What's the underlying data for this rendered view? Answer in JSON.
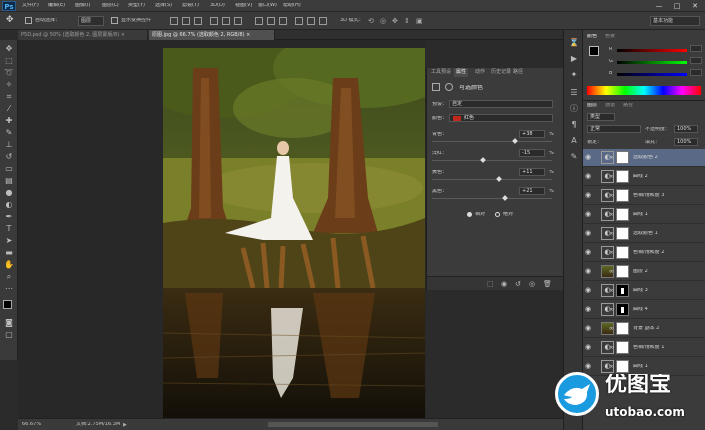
{
  "app": {
    "logo": "Ps"
  },
  "menu": [
    "文件(F)",
    "编辑(E)",
    "图像(I)",
    "图层(L)",
    "类型(Y)",
    "选择(S)",
    "滤镜(T)",
    "3D(D)",
    "视图(V)",
    "窗口(W)",
    "帮助(H)"
  ],
  "window_controls": [
    "—",
    "□",
    "✕"
  ],
  "options": {
    "auto_select_label": "自动选择：",
    "auto_select_value": "图层",
    "show_transform_label": "显示变换控件",
    "mode_3d_label": "3D 模式：",
    "workspace": "基本功能"
  },
  "tabs": [
    {
      "label": "P5D.psd @ 50% (选取颜色 2, 图层蒙版/8) ×",
      "active": false
    },
    {
      "label": "原图.jpg @ 66.7% (选取颜色 2, RGB/8) ×",
      "active": true
    }
  ],
  "status": {
    "zoom": "66.67%",
    "doc": "文档:2.75M/16.3M"
  },
  "properties": {
    "tabs": [
      "工具预设",
      "属性",
      "动作",
      "历史记录",
      "路径"
    ],
    "title": "可选颜色",
    "preset_label": "预设：",
    "preset_value": "自定",
    "colors_label": "颜色：",
    "colors_value": "红色",
    "sliders": [
      {
        "label": "青色：",
        "value": "+38",
        "unit": "%",
        "level": 0.69
      },
      {
        "label": "洋红：",
        "value": "-15",
        "unit": "%",
        "level": 0.425
      },
      {
        "label": "黄色：",
        "value": "+11",
        "unit": "%",
        "level": 0.555
      },
      {
        "label": "黑色：",
        "value": "+21",
        "unit": "%",
        "level": 0.605
      }
    ],
    "method_relative": "相对",
    "method_absolute": "绝对"
  },
  "color_panel": {
    "tab_color": "颜色",
    "tab_swatches": "色板",
    "r": "R",
    "g": "G",
    "b": "B"
  },
  "layers_panel": {
    "tabs": [
      "图层",
      "通道",
      "路径"
    ],
    "kind_label": "类型",
    "blend_mode": "正常",
    "opacity_label": "不透明度：",
    "opacity_value": "100%",
    "lock_label": "锁定：",
    "fill_label": "填充：",
    "fill_value": "100%",
    "layers": [
      {
        "name": "选取颜色 2",
        "kind": "adj",
        "selected": true
      },
      {
        "name": "曲线 2",
        "kind": "adj"
      },
      {
        "name": "色相/饱和度 3",
        "kind": "adj"
      },
      {
        "name": "曲线 1",
        "kind": "adj"
      },
      {
        "name": "选取颜色 1",
        "kind": "adj"
      },
      {
        "name": "色相/饱和度 2",
        "kind": "adj"
      },
      {
        "name": "图层 2",
        "kind": "photo"
      },
      {
        "name": "曲线 3",
        "kind": "mask"
      },
      {
        "name": "曲线 4",
        "kind": "mask"
      },
      {
        "name": "背景 副本 2",
        "kind": "photo"
      },
      {
        "name": "色相/饱和度 1",
        "kind": "adj"
      },
      {
        "name": "曲线 1",
        "kind": "adj"
      }
    ]
  },
  "watermark": {
    "cn": "优图宝",
    "url": "utobao.com"
  },
  "colors": {
    "accent": "#1a9be0",
    "selected_layer": "#5a6a86",
    "reds_swatch": "#c0281c"
  }
}
